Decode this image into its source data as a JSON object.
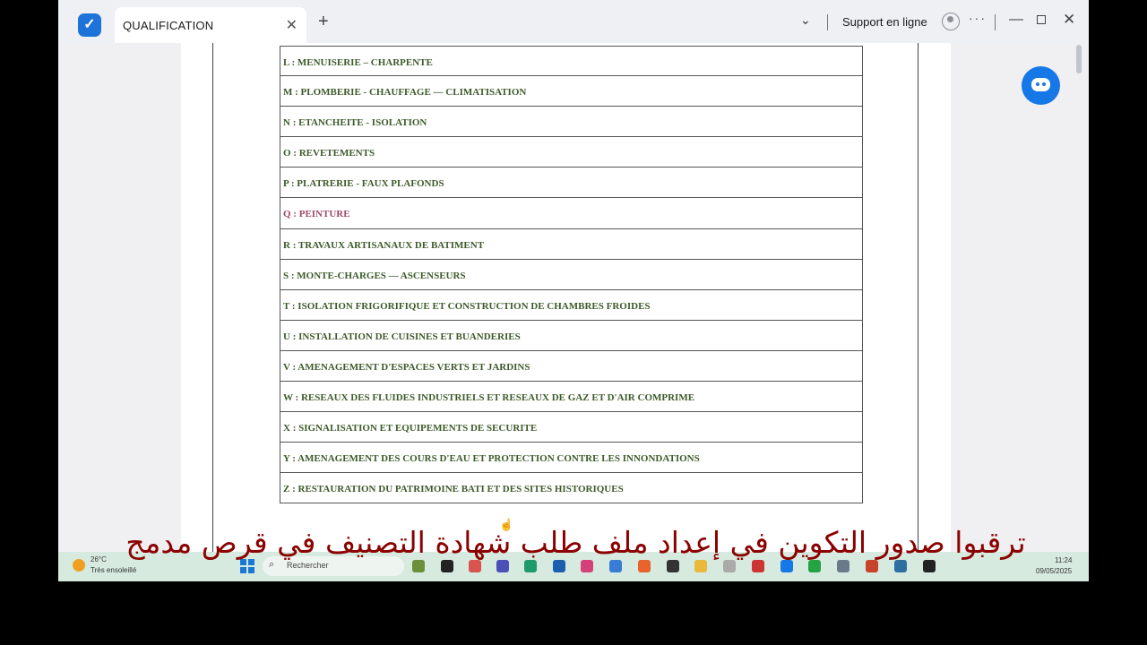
{
  "browser": {
    "tab_title": "QUALIFICATION",
    "tab_close": "✕",
    "new_tab": "+",
    "chevron": "⌄",
    "support_label": "Support en ligne",
    "more": "···",
    "minimize": "—",
    "close": "✕"
  },
  "document": {
    "rows": [
      "L : MENUISERIE – CHARPENTE",
      "M : PLOMBERIE - CHAUFFAGE — CLIMATISATION",
      "N : ETANCHEITE - ISOLATION",
      "O : REVETEMENTS",
      "P : PLATRERIE - FAUX PLAFONDS",
      "Q : PEINTURE",
      "R : TRAVAUX ARTISANAUX DE BATIMENT",
      "S : MONTE-CHARGES — ASCENSEURS",
      "T : ISOLATION FRIGORIFIQUE ET CONSTRUCTION DE CHAMBRES FROIDES",
      "U : INSTALLATION DE CUISINES ET BUANDERIES",
      "V : AMENAGEMENT D'ESPACES VERTS ET JARDINS",
      "W : RESEAUX DES FLUIDES INDUSTRIELS ET RESEAUX DE GAZ ET D'AIR COMPRIME",
      "X : SIGNALISATION ET EQUIPEMENTS DE SECURITE",
      "Y : AMENAGEMENT DES COURS D'EAU ET PROTECTION CONTRE LES INNONDATIONS",
      "Z : RESTAURATION DU PATRIMOINE BATI ET DES SITES HISTORIQUES"
    ],
    "highlight_color": "#9c4a6a",
    "text_color": "#3d5a2a"
  },
  "taskbar": {
    "weather_temp": "26°C",
    "weather_desc": "Très ensoleillé",
    "search_placeholder": "Rechercher",
    "clock_time": "11:24",
    "clock_date": "09/05/2025"
  },
  "caption": "ترقبوا صدور التكوين في إعداد ملف طلب شهادة التصنيف في قرص مدمج",
  "colors": {
    "accent": "#1677e6",
    "caption": "#8b0000"
  }
}
